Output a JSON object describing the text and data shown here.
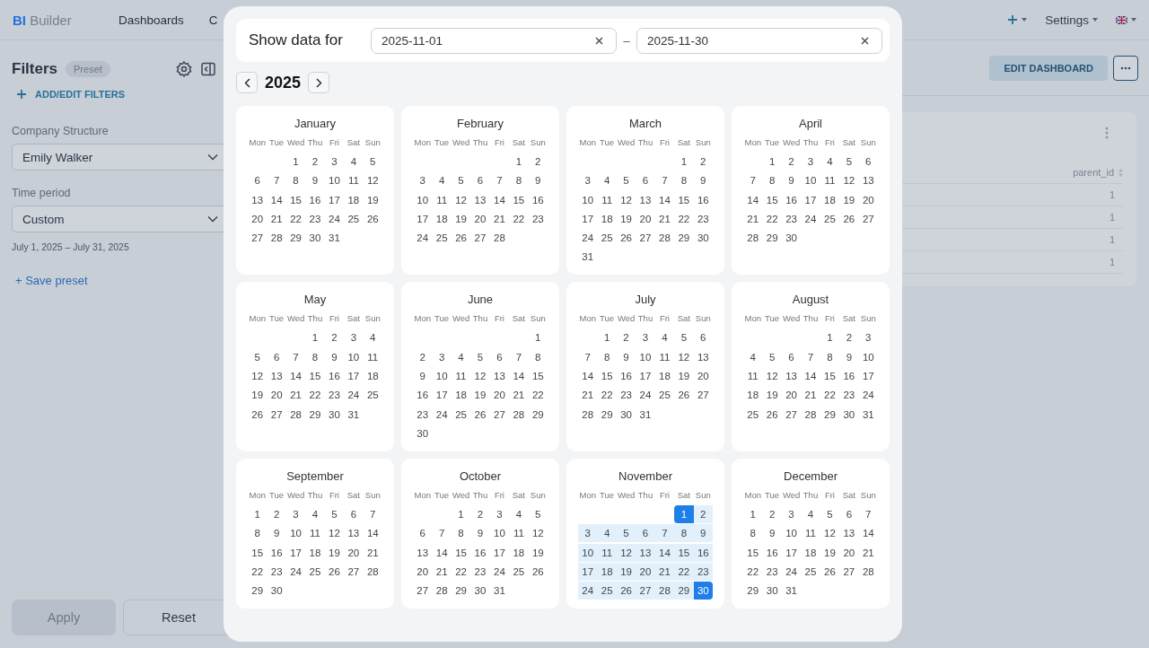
{
  "app": {
    "logo": {
      "accent": "BI",
      "name": "Builder"
    },
    "nav": [
      {
        "label": "Dashboards"
      },
      {
        "label": "C"
      }
    ],
    "settings_label": "Settings"
  },
  "filters": {
    "title": "Filters",
    "preset_badge": {
      "label": "Preset",
      "disabled": true
    },
    "add_filters": "ADD/EDIT FILTERS",
    "fields": [
      {
        "label": "Company Structure",
        "value": "Emily Walker"
      },
      {
        "label": "Time period",
        "value": "Custom",
        "note": "July 1, 2025 – July 31, 2025"
      }
    ],
    "save_preset": "+ Save preset",
    "buttons": [
      {
        "label": "Apply",
        "disabled": true
      },
      {
        "label": "Reset",
        "disabled": false
      }
    ]
  },
  "dashboard": {
    "edit_button": "EDIT DASHBOARD",
    "table": {
      "columns": [
        "parent_id"
      ],
      "rows": [
        [
          "1"
        ],
        [
          "1"
        ],
        [
          "1"
        ],
        [
          "1"
        ]
      ]
    }
  },
  "date_picker": {
    "title": "Show data for",
    "from": "2025-11-01",
    "to": "2025-11-30",
    "separator": "–",
    "year": "2025",
    "months": [
      {
        "name": "January",
        "weekdays": [
          "Mon",
          "Tue",
          "Wed",
          "Thu",
          "Fri",
          "Sat",
          "Sun"
        ],
        "weeks": [
          [
            "1",
            "2",
            "3",
            "4",
            "5"
          ],
          [
            "6",
            "7",
            "8",
            "9",
            "10",
            "11",
            "12"
          ],
          [
            "13",
            "14",
            "15",
            "16",
            "17",
            "18",
            "19"
          ],
          [
            "20",
            "21",
            "22",
            "23",
            "24",
            "25",
            "26"
          ],
          [
            "27",
            "28",
            "29",
            "30",
            "31"
          ]
        ]
      },
      {
        "name": "February",
        "weekdays": [
          "Mon",
          "Tue",
          "Wed",
          "Thu",
          "Fri",
          "Sat",
          "Sun"
        ],
        "weeks": [
          [
            "1",
            "2"
          ],
          [
            "3",
            "4",
            "5",
            "6",
            "7",
            "8",
            "9"
          ],
          [
            "10",
            "11",
            "12",
            "13",
            "14",
            "15",
            "16"
          ],
          [
            "17",
            "18",
            "19",
            "20",
            "21",
            "22",
            "23"
          ],
          [
            "24",
            "25",
            "26",
            "27",
            "28"
          ]
        ]
      },
      {
        "name": "March",
        "weekdays": [
          "Mon",
          "Tue",
          "Wed",
          "Thu",
          "Fri",
          "Sat",
          "Sun"
        ],
        "weeks": [
          [
            "1",
            "2"
          ],
          [
            "3",
            "4",
            "5",
            "6",
            "7",
            "8",
            "9"
          ],
          [
            "10",
            "11",
            "12",
            "13",
            "14",
            "15",
            "16"
          ],
          [
            "17",
            "18",
            "19",
            "20",
            "21",
            "22",
            "23"
          ],
          [
            "24",
            "25",
            "26",
            "27",
            "28",
            "29",
            "30"
          ],
          [
            "31"
          ]
        ]
      },
      {
        "name": "April",
        "weekdays": [
          "Mon",
          "Tue",
          "Wed",
          "Thu",
          "Fri",
          "Sat",
          "Sun"
        ],
        "weeks": [
          [
            "1",
            "2",
            "3",
            "4",
            "5",
            "6"
          ],
          [
            "7",
            "8",
            "9",
            "10",
            "11",
            "12",
            "13"
          ],
          [
            "14",
            "15",
            "16",
            "17",
            "18",
            "19",
            "20"
          ],
          [
            "21",
            "22",
            "23",
            "24",
            "25",
            "26",
            "27"
          ],
          [
            "28",
            "29",
            "30"
          ]
        ]
      },
      {
        "name": "May",
        "weekdays": [
          "Mon",
          "Tue",
          "Wed",
          "Thu",
          "Fri",
          "Sat",
          "Sun"
        ],
        "weeks": [
          [
            "1",
            "2",
            "3",
            "4"
          ],
          [
            "5",
            "6",
            "7",
            "8",
            "9",
            "10",
            "11"
          ],
          [
            "12",
            "13",
            "14",
            "15",
            "16",
            "17",
            "18"
          ],
          [
            "19",
            "20",
            "21",
            "22",
            "23",
            "24",
            "25"
          ],
          [
            "26",
            "27",
            "28",
            "29",
            "30",
            "31"
          ]
        ]
      },
      {
        "name": "June",
        "weekdays": [
          "Mon",
          "Tue",
          "Wed",
          "Thu",
          "Fri",
          "Sat",
          "Sun"
        ],
        "weeks": [
          [
            "1"
          ],
          [
            "2",
            "3",
            "4",
            "5",
            "6",
            "7",
            "8"
          ],
          [
            "9",
            "10",
            "11",
            "12",
            "13",
            "14",
            "15"
          ],
          [
            "16",
            "17",
            "18",
            "19",
            "20",
            "21",
            "22"
          ],
          [
            "23",
            "24",
            "25",
            "26",
            "27",
            "28",
            "29"
          ],
          [
            "30"
          ]
        ]
      },
      {
        "name": "July",
        "weekdays": [
          "Mon",
          "Tue",
          "Wed",
          "Thu",
          "Fri",
          "Sat",
          "Sun"
        ],
        "weeks": [
          [
            "1",
            "2",
            "3",
            "4",
            "5",
            "6"
          ],
          [
            "7",
            "8",
            "9",
            "10",
            "11",
            "12",
            "13"
          ],
          [
            "14",
            "15",
            "16",
            "17",
            "18",
            "19",
            "20"
          ],
          [
            "21",
            "22",
            "23",
            "24",
            "25",
            "26",
            "27"
          ],
          [
            "28",
            "29",
            "30",
            "31"
          ]
        ]
      },
      {
        "name": "August",
        "weekdays": [
          "Mon",
          "Tue",
          "Wed",
          "Thu",
          "Fri",
          "Sat",
          "Sun"
        ],
        "weeks": [
          [
            "1",
            "2",
            "3"
          ],
          [
            "4",
            "5",
            "6",
            "7",
            "8",
            "9",
            "10"
          ],
          [
            "11",
            "12",
            "13",
            "14",
            "15",
            "16",
            "17"
          ],
          [
            "18",
            "19",
            "20",
            "21",
            "22",
            "23",
            "24"
          ],
          [
            "25",
            "26",
            "27",
            "28",
            "29",
            "30",
            "31"
          ]
        ]
      },
      {
        "name": "September",
        "weekdays": [
          "Mon",
          "Tue",
          "Wed",
          "Thu",
          "Fri",
          "Sat",
          "Sun"
        ],
        "weeks": [
          [
            "1",
            "2",
            "3",
            "4",
            "5",
            "6",
            "7"
          ],
          [
            "8",
            "9",
            "10",
            "11",
            "12",
            "13",
            "14"
          ],
          [
            "15",
            "16",
            "17",
            "18",
            "19",
            "20",
            "21"
          ],
          [
            "22",
            "23",
            "24",
            "25",
            "26",
            "27",
            "28"
          ],
          [
            "29",
            "30"
          ]
        ]
      },
      {
        "name": "October",
        "weekdays": [
          "Mon",
          "Tue",
          "Wed",
          "Thu",
          "Fri",
          "Sat",
          "Sun"
        ],
        "weeks": [
          [
            "1",
            "2",
            "3",
            "4",
            "5"
          ],
          [
            "6",
            "7",
            "8",
            "9",
            "10",
            "11",
            "12"
          ],
          [
            "13",
            "14",
            "15",
            "16",
            "17",
            "18",
            "19"
          ],
          [
            "20",
            "21",
            "22",
            "23",
            "24",
            "25",
            "26"
          ],
          [
            "27",
            "28",
            "29",
            "30",
            "31"
          ]
        ]
      },
      {
        "name": "November",
        "weekdays": [
          "Mon",
          "Tue",
          "Wed",
          "Thu",
          "Fri",
          "Sat",
          "Sun"
        ],
        "weeks": [
          [
            {
              "day": "1",
              "selected": true,
              "in_range": true
            },
            {
              "day": "2",
              "selected": false,
              "in_range": true
            }
          ],
          [
            {
              "day": "3",
              "selected": false,
              "in_range": true
            },
            {
              "day": "4",
              "selected": false,
              "in_range": true
            },
            {
              "day": "5",
              "selected": false,
              "in_range": true
            },
            {
              "day": "6",
              "selected": false,
              "in_range": true
            },
            {
              "day": "7",
              "selected": false,
              "in_range": true
            },
            {
              "day": "8",
              "selected": false,
              "in_range": true
            },
            {
              "day": "9",
              "selected": false,
              "in_range": true
            }
          ],
          [
            {
              "day": "10",
              "selected": false,
              "in_range": true
            },
            {
              "day": "11",
              "selected": false,
              "in_range": true
            },
            {
              "day": "12",
              "selected": false,
              "in_range": true
            },
            {
              "day": "13",
              "selected": false,
              "in_range": true
            },
            {
              "day": "14",
              "selected": false,
              "in_range": true
            },
            {
              "day": "15",
              "selected": false,
              "in_range": true
            },
            {
              "day": "16",
              "selected": false,
              "in_range": true
            }
          ],
          [
            {
              "day": "17",
              "selected": false,
              "in_range": true
            },
            {
              "day": "18",
              "selected": false,
              "in_range": true
            },
            {
              "day": "19",
              "selected": false,
              "in_range": true
            },
            {
              "day": "20",
              "selected": false,
              "in_range": true
            },
            {
              "day": "21",
              "selected": false,
              "in_range": true
            },
            {
              "day": "22",
              "selected": false,
              "in_range": true
            },
            {
              "day": "23",
              "selected": false,
              "in_range": true
            }
          ],
          [
            {
              "day": "24",
              "selected": false,
              "in_range": true
            },
            {
              "day": "25",
              "selected": false,
              "in_range": true
            },
            {
              "day": "26",
              "selected": false,
              "in_range": true
            },
            {
              "day": "27",
              "selected": false,
              "in_range": true
            },
            {
              "day": "28",
              "selected": false,
              "in_range": true
            },
            {
              "day": "29",
              "selected": false,
              "in_range": true
            },
            {
              "day": "30",
              "selected": true,
              "in_range": true
            }
          ]
        ]
      },
      {
        "name": "December",
        "weekdays": [
          "Mon",
          "Tue",
          "Wed",
          "Thu",
          "Fri",
          "Sat",
          "Sun"
        ],
        "weeks": [
          [
            "1",
            "2",
            "3",
            "4",
            "5",
            "6",
            "7"
          ],
          [
            "8",
            "9",
            "10",
            "11",
            "12",
            "13",
            "14"
          ],
          [
            "15",
            "16",
            "17",
            "18",
            "19",
            "20",
            "21"
          ],
          [
            "22",
            "23",
            "24",
            "25",
            "26",
            "27",
            "28"
          ],
          [
            "29",
            "30",
            "31"
          ]
        ]
      }
    ]
  }
}
